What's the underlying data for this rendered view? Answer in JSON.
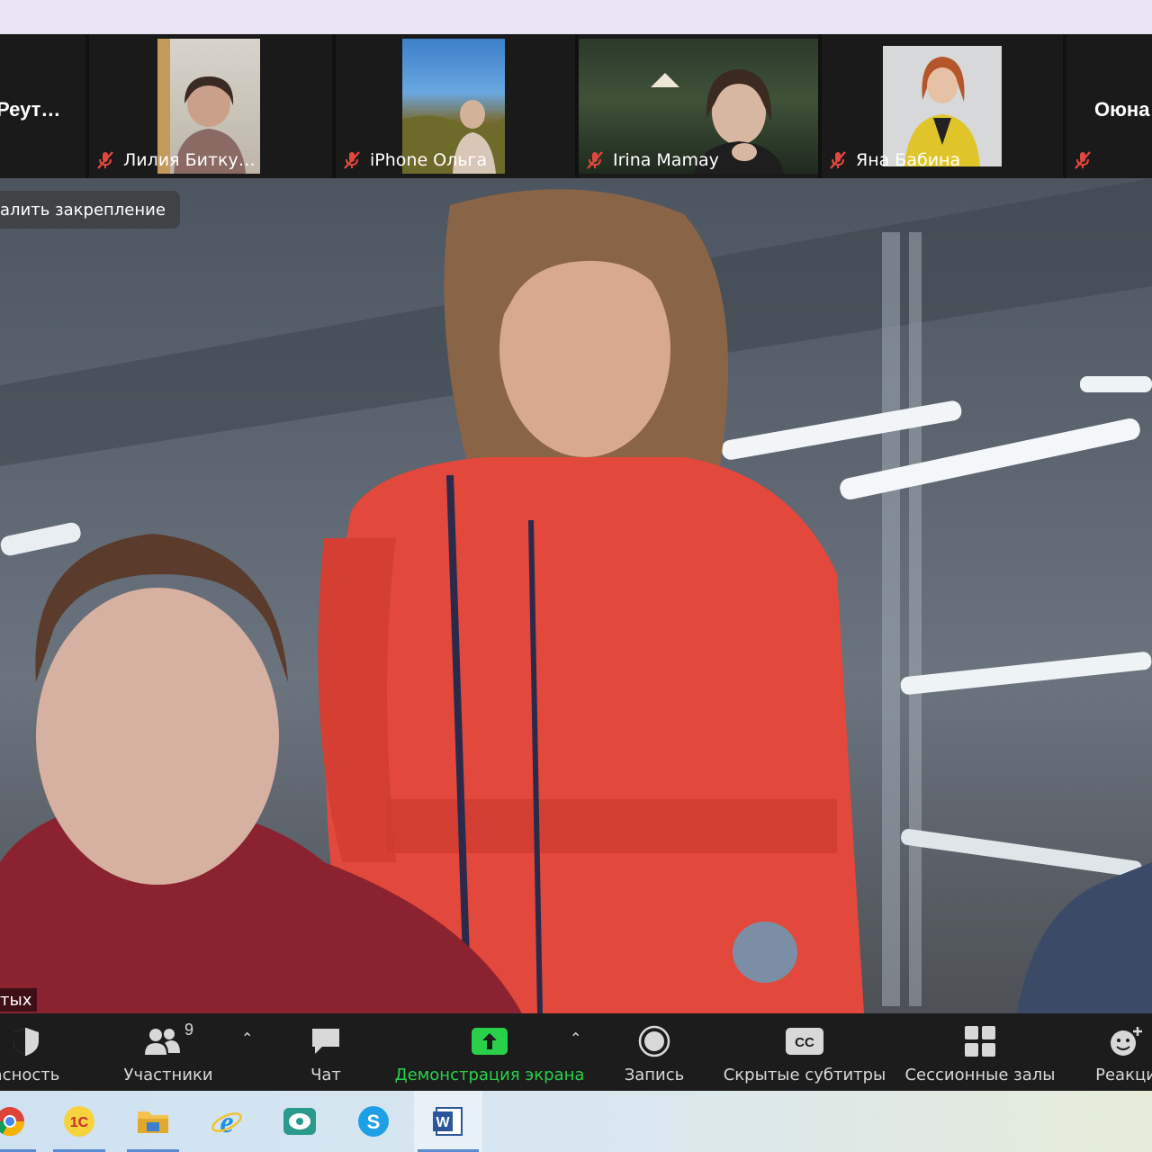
{
  "participants": [
    {
      "name": "Реут…",
      "type": "name-only"
    },
    {
      "name": "Лилия Битку…",
      "type": "video",
      "muted": true
    },
    {
      "name": "iPhone Ольга",
      "type": "video",
      "muted": true
    },
    {
      "name": "Irina Mamay",
      "type": "video",
      "muted": true
    },
    {
      "name": "Яна Бабина",
      "type": "video",
      "muted": true
    },
    {
      "name": "Оюна",
      "type": "name-only",
      "muted": true
    }
  ],
  "main": {
    "unpin_label": "алить закрепление",
    "speaker_name": "тых"
  },
  "toolbar": {
    "security_label": "асность",
    "participants_label": "Участники",
    "participants_count": "9",
    "chat_label": "Чат",
    "share_label": "Демонстрация экрана",
    "record_label": "Запись",
    "captions_label": "Скрытые субтитры",
    "breakout_label": "Сессионные залы",
    "reactions_label": "Реакци"
  },
  "taskbar": {
    "apps": [
      "chrome-icon",
      "1c-icon",
      "file-explorer-icon",
      "internet-explorer-icon",
      "messenger-icon",
      "skype-icon",
      "word-icon"
    ]
  },
  "colors": {
    "share_green": "#29d14a",
    "mute_red": "#e0483e",
    "toolbar_bg": "#1c1c1c"
  }
}
